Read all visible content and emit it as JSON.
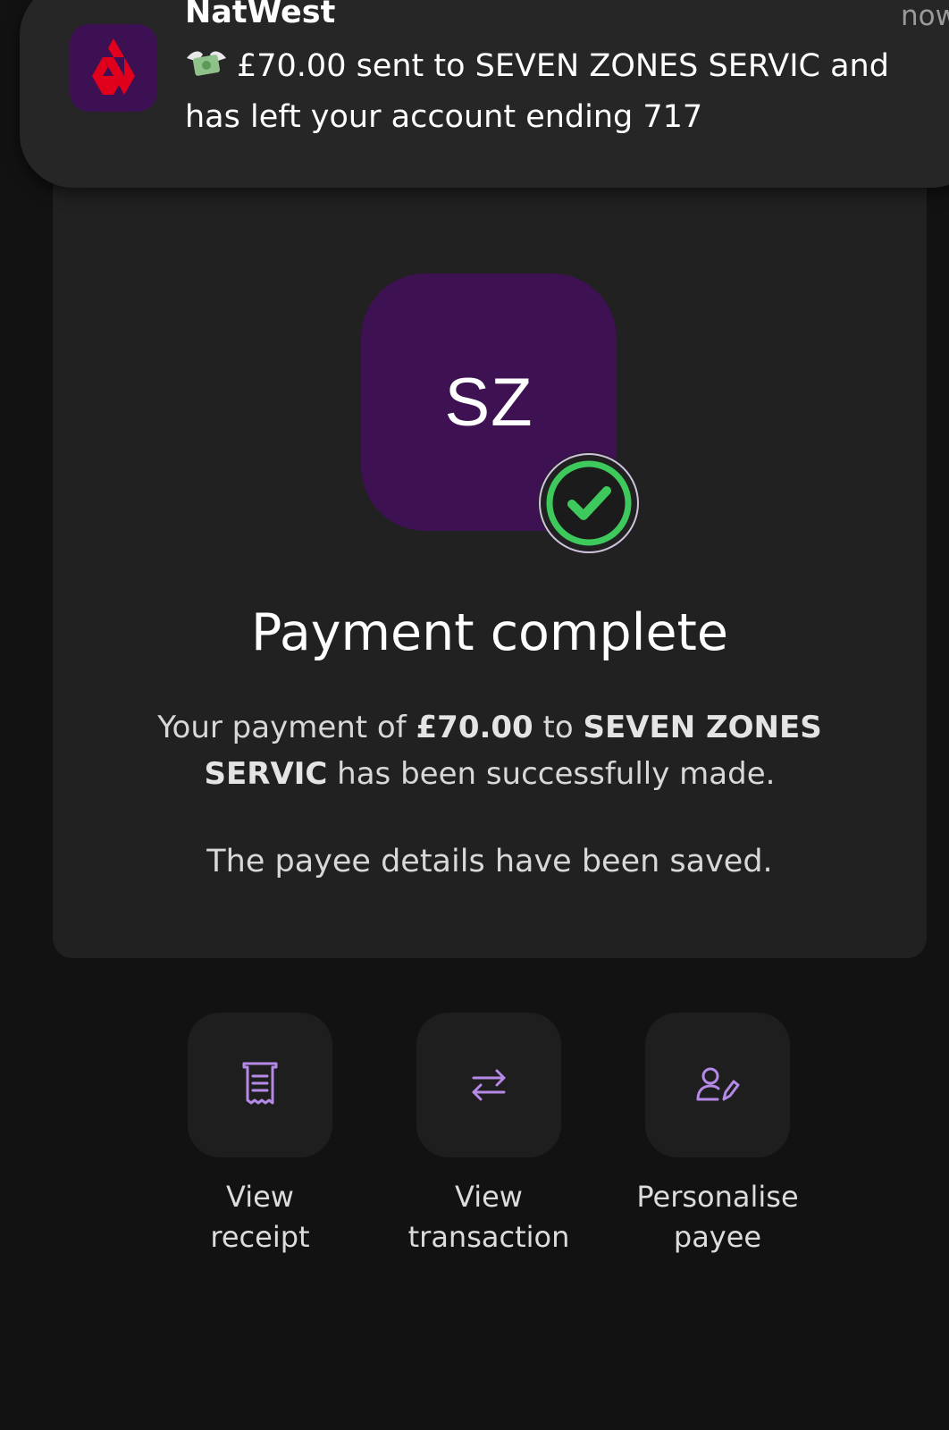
{
  "notification": {
    "app_name": "NatWest",
    "time": "now",
    "message": "£70.00 sent to SEVEN ZONES SERVIC and has left your account ending 717",
    "icon": "natwest-logo",
    "emoji": "money-with-wings"
  },
  "payee": {
    "initials": "SZ",
    "status_icon": "check-circle-icon"
  },
  "result": {
    "title": "Payment complete",
    "body_prefix": "Your payment of ",
    "amount": "£70.00",
    "body_middle": " to ",
    "payee_name": "SEVEN ZONES SERVIC",
    "body_suffix": " has been successfully made.",
    "saved_message": "The payee details have been saved."
  },
  "actions": [
    {
      "label": "View\nreceipt",
      "icon": "receipt-icon"
    },
    {
      "label": "View\ntransaction",
      "icon": "transfer-arrows-icon"
    },
    {
      "label": "Personalise\npayee",
      "icon": "user-edit-icon"
    }
  ],
  "colors": {
    "background": "#121212",
    "card": "#212121",
    "avatar": "#3d1152",
    "success": "#3ec95c",
    "accent": "#b48ae6",
    "brand_red": "#e0001b"
  }
}
